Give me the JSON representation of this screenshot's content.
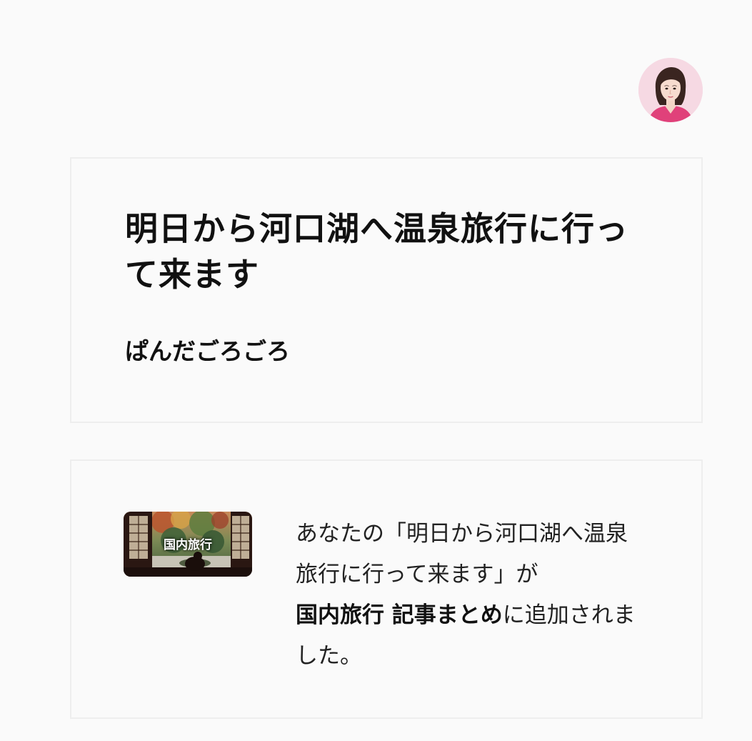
{
  "header": {
    "avatar_icon": "woman-portrait-avatar"
  },
  "article": {
    "title": "明日から河口湖へ温泉旅行に行って来ます",
    "author": "ぱんだごろごろ"
  },
  "notice": {
    "thumbnail_label": "国内旅行",
    "text_prefix": "あなたの「明日から河口湖へ温泉旅行に行って来ます」が",
    "magazine_name": "国内旅行 記事まとめ",
    "text_suffix": "に追加されました。"
  },
  "colors": {
    "background": "#fafafa",
    "border": "#eeeeee",
    "text": "#111111",
    "avatar_bg": "#f6d9e3"
  }
}
